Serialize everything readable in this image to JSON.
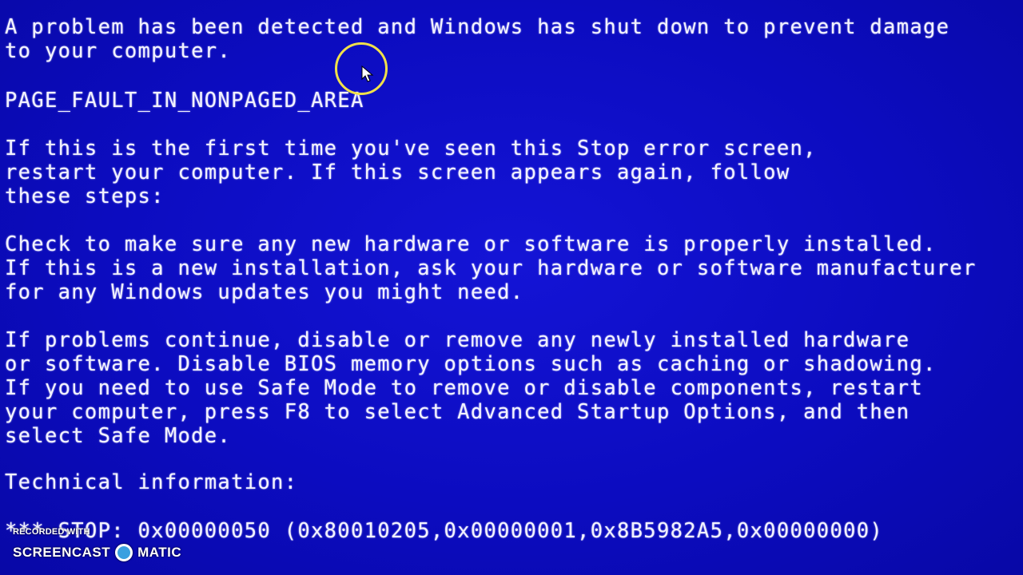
{
  "bsod": {
    "background_color": "#0c0cc0",
    "text_color": "#f2f2ff",
    "lines": [
      "A problem has been detected and Windows has shut down to prevent damage",
      "to your computer.",
      "PAGE_FAULT_IN_NONPAGED_AREA",
      "If this is the first time you've seen this Stop error screen,",
      "restart your computer. If this screen appears again, follow",
      "these steps:",
      "Check to make sure any new hardware or software is properly installed.",
      "If this is a new installation, ask your hardware or software manufacturer",
      "for any Windows updates you might need.",
      "If problems continue, disable or remove any newly installed hardware",
      "or software. Disable BIOS memory options such as caching or shadowing.",
      "If you need to use Safe Mode to remove or disable components, restart",
      "your computer, press F8 to select Advanced Startup Options, and then",
      "select Safe Mode.",
      "Technical information:",
      "*** STOP: 0x00000050 (0x80010205,0x00000001,0x8B5982A5,0x00000000)"
    ]
  },
  "cursor": {
    "icon": "mouse-pointer-icon",
    "highlight_color": "#f0e04a"
  },
  "watermark": {
    "recorded_with": "RECORDED WITH",
    "brand_left": "SCREENCAST",
    "brand_right": "MATIC",
    "logo_icon": "screencast-o-matic-logo-icon",
    "logo_color": "#3aa0e0"
  }
}
